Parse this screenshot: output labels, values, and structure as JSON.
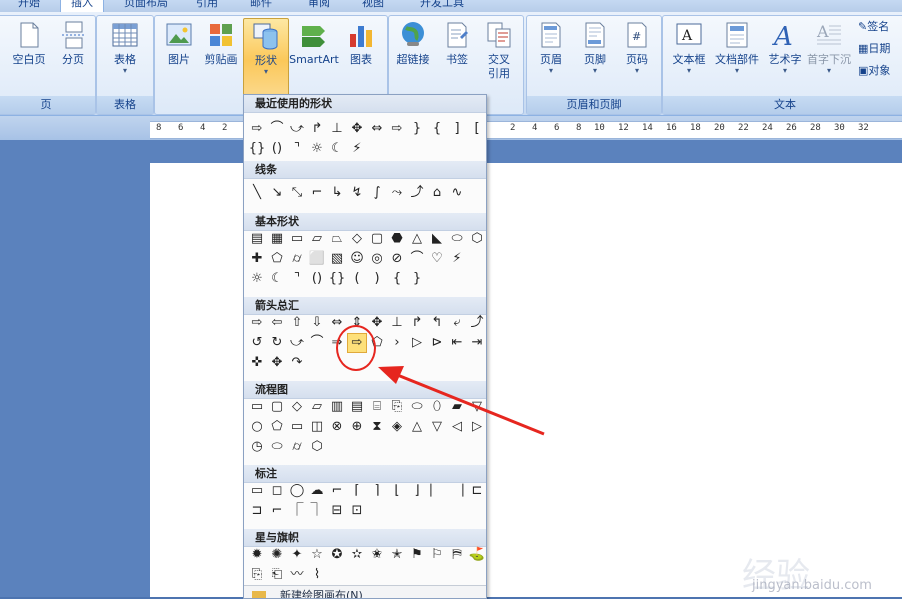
{
  "tabs": [
    {
      "label": "开始",
      "active": false
    },
    {
      "label": "插入",
      "active": true
    },
    {
      "label": "页面布局",
      "active": false
    },
    {
      "label": "引用",
      "active": false
    },
    {
      "label": "邮件",
      "active": false
    },
    {
      "label": "审阅",
      "active": false
    },
    {
      "label": "视图",
      "active": false
    },
    {
      "label": "开发工具",
      "active": false
    }
  ],
  "ribbon": {
    "pages": {
      "label": "页",
      "buttons": [
        "空白页",
        "分页"
      ]
    },
    "tables": {
      "label": "表格",
      "buttons": [
        "表格"
      ]
    },
    "illustrations": {
      "buttons": [
        "图片",
        "剪贴画",
        "形状",
        "SmartArt",
        "图表"
      ]
    },
    "links": {
      "buttons": [
        "超链接",
        "书签",
        "交叉",
        "引用"
      ]
    },
    "headerfooter": {
      "label": "页眉和页脚",
      "buttons": [
        "页眉",
        "页脚",
        "页码"
      ]
    },
    "text": {
      "label": "文本",
      "buttons": [
        "文本框",
        "文档部件",
        "艺术字",
        "首字下沉"
      ]
    },
    "small": [
      "签名",
      "日期",
      "对象"
    ]
  },
  "ruler": [
    "8",
    "6",
    "4",
    "2",
    "2",
    "4",
    "6",
    "8",
    "10",
    "12",
    "14",
    "16",
    "18",
    "20",
    "22",
    "24",
    "26",
    "28",
    "30",
    "32"
  ],
  "shapes_menu": {
    "sections": [
      {
        "title": "最近使用的形状",
        "rows": [
          [
            "⇨",
            "⌒",
            "⤻",
            "↱",
            "⊥",
            "✥",
            "⇔",
            "⇨",
            "}",
            "{",
            "]",
            "["
          ],
          [
            "{}",
            "()",
            "⌝",
            "☼",
            "☾",
            "⚡"
          ]
        ]
      },
      {
        "title": "线条",
        "rows": [
          [
            "╲",
            "↘",
            "⤡",
            "⌐",
            "↳",
            "↯",
            "∫",
            "⤳",
            "⤴",
            "⌂",
            "∿"
          ]
        ]
      },
      {
        "title": "基本形状",
        "rows": [
          [
            "▤",
            "▦",
            "▭",
            "▱",
            "⏢",
            "◇",
            "▢",
            "⬣",
            "△",
            "◣",
            "⬭",
            "⬡"
          ],
          [
            "✚",
            "⬠",
            "⌭",
            "⬜",
            "▧",
            "☺",
            "◎",
            "⊘",
            "⌒",
            "♡",
            "⚡"
          ],
          [
            "☼",
            "☾",
            "⌝",
            "()",
            "{}",
            "(",
            ")",
            "{",
            "}"
          ]
        ]
      },
      {
        "title": "箭头总汇",
        "rows": [
          [
            "⇨",
            "⇦",
            "⇧",
            "⇩",
            "⇔",
            "⇕",
            "✥",
            "⊥",
            "↱",
            "↰",
            "⤶",
            "⤴"
          ],
          [
            "↺",
            "↻",
            "⤻",
            "⌒",
            "⇒",
            "⇨",
            "⬠",
            "›",
            "▷",
            "⊳",
            "⇤",
            "⇥"
          ],
          [
            "✜",
            "✥",
            "↷"
          ]
        ]
      },
      {
        "title": "流程图",
        "rows": [
          [
            "▭",
            "▢",
            "◇",
            "▱",
            "▥",
            "▤",
            "⌸",
            "⎘",
            "⬭",
            "⬯",
            "▰",
            "▽"
          ],
          [
            "○",
            "⬠",
            "▭",
            "◫",
            "⊗",
            "⊕",
            "⧗",
            "◈",
            "△",
            "▽",
            "◁",
            "▷"
          ],
          [
            "◷",
            "⬭",
            "⌭",
            "⬡"
          ]
        ]
      },
      {
        "title": "标注",
        "rows": [
          [
            "▭",
            "◻",
            "◯",
            "☁",
            "⌐",
            "⌈",
            "⌉",
            "⌊",
            "⌋",
            "⎸",
            "⎹",
            "⊏"
          ],
          [
            "⊐",
            "⌐",
            "⎾",
            "⏋",
            "⊟",
            "⊡"
          ]
        ]
      },
      {
        "title": "星与旗帜",
        "rows": [
          [
            "✹",
            "✺",
            "✦",
            "☆",
            "✪",
            "✫",
            "✬",
            "✭",
            "⚑",
            "⚐",
            "⛿",
            "⛳"
          ],
          [
            "⎘",
            "⎗",
            "〰",
            "⌇"
          ]
        ]
      }
    ],
    "footer": "新建绘图画布(N)"
  },
  "watermark": {
    "line1": "Bai",
    "line2": "经验",
    "line3": "jingyan.baidu.com"
  },
  "colors": {
    "accent": "#e6261f",
    "ribbon_active": "#fbc85a",
    "selected_shape": "#fde07a"
  }
}
